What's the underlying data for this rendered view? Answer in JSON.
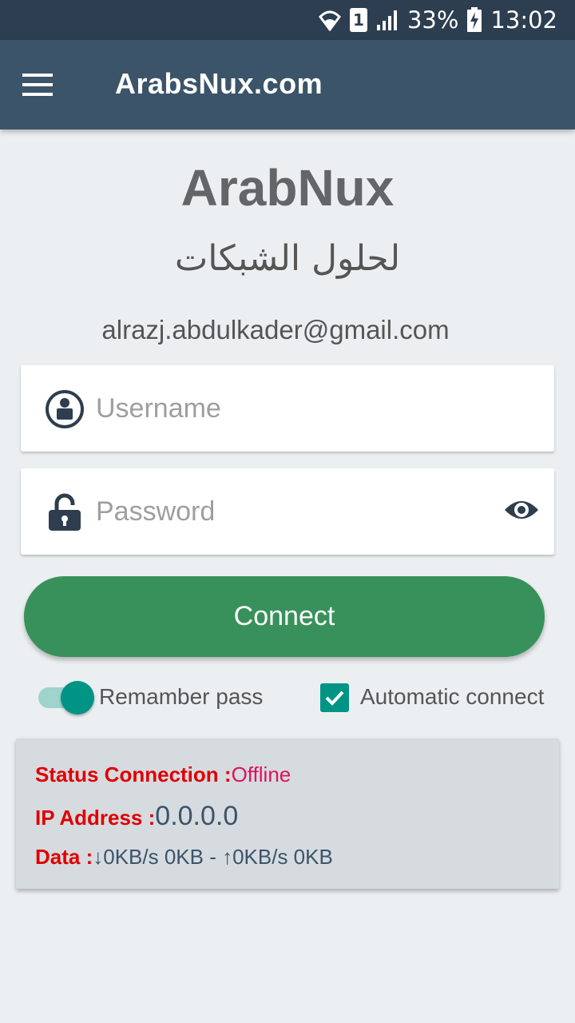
{
  "status_bar": {
    "sim_slot": "1",
    "battery": "33%",
    "time": "13:02",
    "icons": [
      "wifi-icon",
      "sim-icon",
      "signal-icon",
      "battery-charging-icon"
    ]
  },
  "app_bar": {
    "title": "ArabsNux.com",
    "menu_icon": "hamburger-menu-icon"
  },
  "header": {
    "brand": "ArabNux",
    "subtitle": "لحلول الشبكات",
    "email": "alrazj.abdulkader@gmail.com"
  },
  "form": {
    "username": {
      "value": "",
      "placeholder": "Username",
      "icon": "user-circle-icon"
    },
    "password": {
      "value": "",
      "placeholder": "Password",
      "icon": "unlock-icon",
      "toggle_icon": "eye-icon"
    },
    "connect_label": "Connect",
    "remember_label": "Remamber pass",
    "remember_on": true,
    "auto_label": "Automatic connect",
    "auto_checked": true
  },
  "status": {
    "connection_label": "Status Connection :",
    "connection_value": "Offline",
    "ip_label": "IP Address :",
    "ip_value": "0.0.0.0",
    "data_label": "Data :",
    "data_value": "↓0KB/s 0KB - ↑0KB/s 0KB"
  },
  "colors": {
    "status_bar": "#2c3e50",
    "app_bar": "#3b5469",
    "background": "#eceff1",
    "connect_button": "#38915a",
    "accent": "#009485",
    "status_label": "#e00000",
    "status_value": "#e0105a"
  }
}
